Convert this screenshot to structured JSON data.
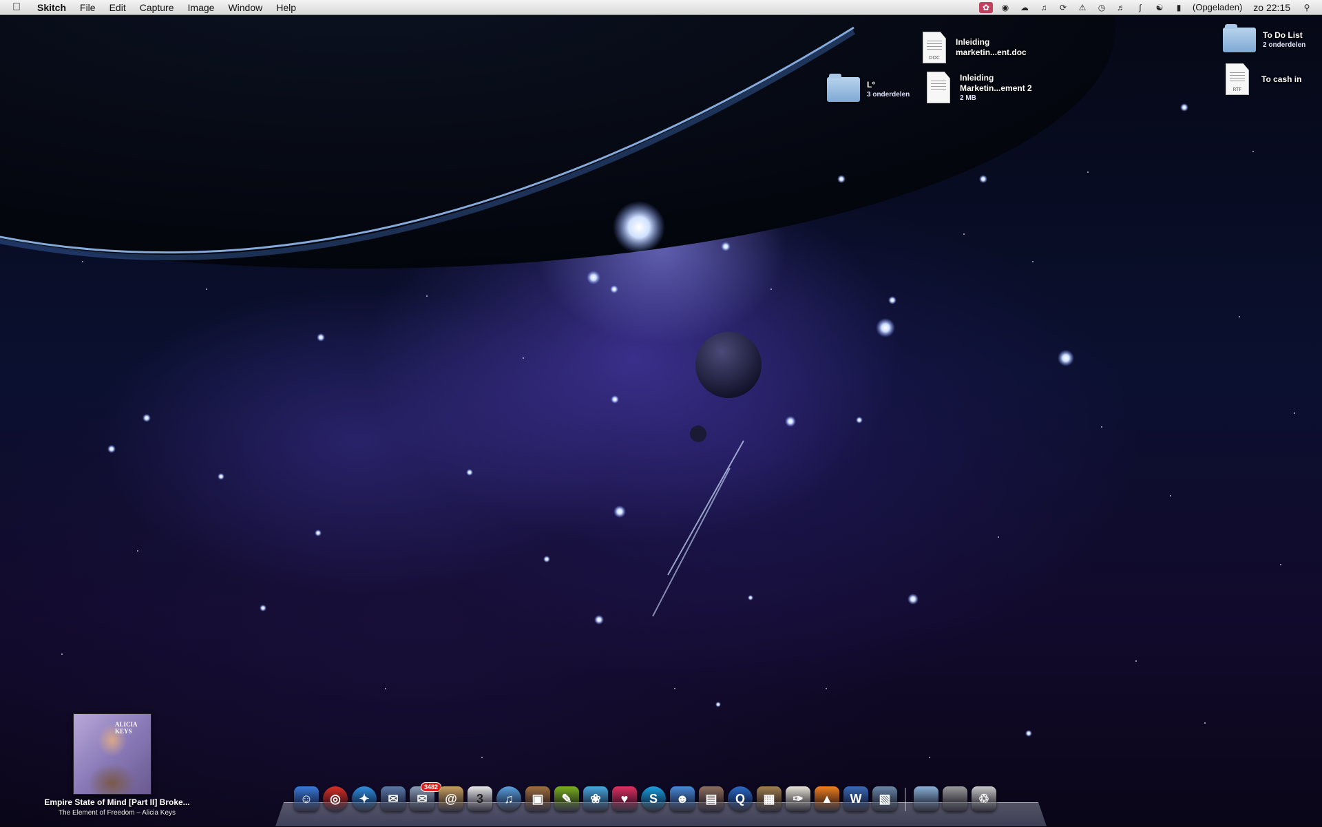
{
  "menubar": {
    "app_name": "Skitch",
    "items": [
      "File",
      "Edit",
      "Capture",
      "Image",
      "Window",
      "Help"
    ],
    "battery_text": "(Opgeladen)",
    "clock": "zo 22:15",
    "status_icons": [
      "skitch-status-icon",
      "globe-icon",
      "cloud-icon",
      "music-note-icon",
      "sync-icon",
      "alert-icon",
      "time-machine-icon",
      "volume-icon",
      "bluetooth-icon",
      "wifi-icon",
      "battery-icon",
      "spotlight-icon"
    ]
  },
  "desktop": {
    "items": [
      {
        "name": "Inleiding marketin...ent.doc",
        "line1": "Inleiding",
        "line2": "marketin...ent.doc",
        "sub": "",
        "kind": "doc",
        "tag": "DOC"
      },
      {
        "name": "L°",
        "line1": "L°",
        "line2": "",
        "sub": "3 onderdelen",
        "kind": "folder"
      },
      {
        "name": "Inleiding Marketin...ement 2",
        "line1": "Inleiding",
        "line2": "Marketin...ement 2",
        "sub": "2 MB",
        "kind": "doc",
        "tag": ""
      },
      {
        "name": "To Do List",
        "line1": "To Do List",
        "line2": "",
        "sub": "2 onderdelen",
        "kind": "folder"
      },
      {
        "name": "To cash in",
        "line1": "To cash in",
        "line2": "",
        "sub": "",
        "kind": "doc",
        "tag": "RTF"
      }
    ]
  },
  "now_playing": {
    "title": "Empire State of Mind [Part II] Broke...",
    "subtitle": "The Element of Freedom – Alicia Keys",
    "art_text": "ALICIA KEYS"
  },
  "dock": {
    "apps": [
      {
        "name": "finder",
        "glyph": "☺",
        "color": "#3a7ad8"
      },
      {
        "name": "chrome",
        "glyph": "◎",
        "color": "#d93025"
      },
      {
        "name": "safari",
        "glyph": "✦",
        "color": "#2f8fe0"
      },
      {
        "name": "mail-stamp",
        "glyph": "✉",
        "color": "#5a7aa8"
      },
      {
        "name": "mail",
        "glyph": "✉",
        "color": "#8aa0b8",
        "badge": "3482"
      },
      {
        "name": "address-book",
        "glyph": "@",
        "color": "#c8a060"
      },
      {
        "name": "ical",
        "glyph": "3",
        "color": "#e8e8e8"
      },
      {
        "name": "itunes",
        "glyph": "♫",
        "color": "#5aa0e0"
      },
      {
        "name": "iphoto",
        "glyph": "▣",
        "color": "#a07040"
      },
      {
        "name": "pen-tool",
        "glyph": "✎",
        "color": "#7ab020"
      },
      {
        "name": "twitter-bird",
        "glyph": "❀",
        "color": "#4aa8e0"
      },
      {
        "name": "heart-app",
        "glyph": "♥",
        "color": "#e03060"
      },
      {
        "name": "skype",
        "glyph": "S",
        "color": "#1aa0e0"
      },
      {
        "name": "messenger",
        "glyph": "☻",
        "color": "#4a8ad8"
      },
      {
        "name": "photo-app",
        "glyph": "▤",
        "color": "#907060"
      },
      {
        "name": "quicktime",
        "glyph": "Q",
        "color": "#2a6ac8"
      },
      {
        "name": "archive",
        "glyph": "▦",
        "color": "#a08050"
      },
      {
        "name": "textedit",
        "glyph": "✑",
        "color": "#e8e4d8"
      },
      {
        "name": "vlc",
        "glyph": "▲",
        "color": "#f08020"
      },
      {
        "name": "word",
        "glyph": "W",
        "color": "#3a6ab8"
      },
      {
        "name": "preview",
        "glyph": "▧",
        "color": "#6a88a8"
      }
    ],
    "stack_items": [
      {
        "name": "documents-folder",
        "glyph": "",
        "color": "#8ab0d8"
      },
      {
        "name": "downloads-stack",
        "glyph": "",
        "color": "#9a9a9a"
      },
      {
        "name": "trash",
        "glyph": "♲",
        "color": "#c8c8c8"
      }
    ]
  }
}
